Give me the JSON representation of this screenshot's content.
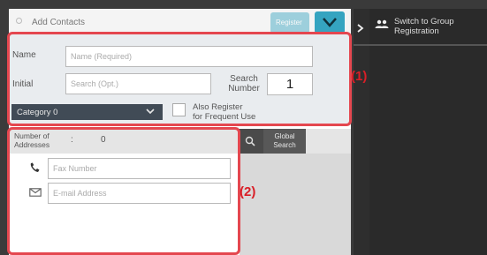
{
  "header": {
    "title": "Add Contacts",
    "top_button_label": "Register"
  },
  "form": {
    "name_label": "Name",
    "name_placeholder": "Name (Required)",
    "initial_label": "Initial",
    "initial_placeholder": "Search (Opt.)",
    "search_number_label_line1": "Search",
    "search_number_label_line2": "Number",
    "search_number_value": "1",
    "category_value": "Category 0",
    "frequent_use_line1": "Also Register",
    "frequent_use_line2": "for Frequent Use"
  },
  "addresses": {
    "count_label_line1": "Number of",
    "count_label_line2": "Addresses",
    "count_sep": ":",
    "count_value": "0",
    "global_search_line1": "Global",
    "global_search_line2": "Search",
    "fax_placeholder": "Fax Number",
    "email_placeholder": "E-mail Address"
  },
  "right": {
    "switch_line1": "Switch to Group",
    "switch_line2": "Registration"
  },
  "callouts": {
    "one": "(1)",
    "two": "(2)"
  },
  "colors": {
    "accent": "#35a4c0",
    "callout": "#e4474f",
    "dropdown": "#414b56"
  },
  "icons": [
    "arrow-right-icon",
    "group-icon",
    "chevron-down-icon",
    "phone-icon",
    "mail-icon",
    "magnifier-icon"
  ]
}
